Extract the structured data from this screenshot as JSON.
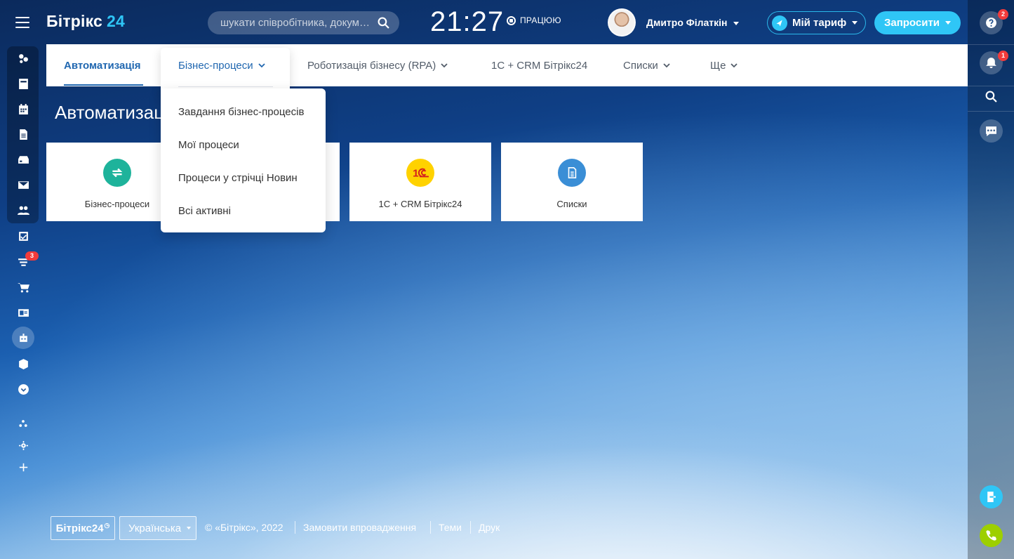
{
  "header": {
    "logo_text": "Бітрікс",
    "logo_num": "24",
    "search_placeholder": "шукати співробітника, докум…",
    "clock": "21:27",
    "status": "ПРАЦЮЮ",
    "user_name": "Дмитро Філаткін",
    "tariff_label": "Мій тариф",
    "invite_label": "Запросити"
  },
  "left_sidebar": {
    "badge": "3",
    "icons": [
      "feed-icon",
      "chat-icon",
      "calendar-icon",
      "documents-icon",
      "drive-icon",
      "mail-icon",
      "groups-icon",
      "tasks-icon",
      "crm-funnel-icon",
      "shop-icon",
      "contact-center-icon",
      "automation-robot-icon",
      "store-box-icon",
      "more-chevron-icon",
      "sitemap-icon",
      "settings-gear-icon",
      "add-plus-icon"
    ]
  },
  "right_bar": {
    "help_badge": "2",
    "notif_badge": "1"
  },
  "nav": {
    "items": [
      {
        "label": "Автоматизація"
      },
      {
        "label": "Бізнес-процеси"
      },
      {
        "label": "Роботизація бізнесу (RPA)"
      },
      {
        "label": "1С + CRM Бітрікс24"
      },
      {
        "label": "Списки"
      },
      {
        "label": "Ще"
      }
    ]
  },
  "page": {
    "title": "Автоматизація"
  },
  "tiles": [
    {
      "label": "Бізнес-процеси",
      "color": "#1eb39b"
    },
    {
      "label": "1С + CRM Бітрікс24",
      "color": "#ffd200"
    },
    {
      "label": "Списки",
      "color": "#3a8ed6"
    }
  ],
  "dropdown": {
    "items": [
      {
        "label": "Завдання бізнес-процесів"
      },
      {
        "label": "Мої процеси"
      },
      {
        "label": "Процеси у стрічці Новин"
      },
      {
        "label": "Всі активні"
      }
    ]
  },
  "footer": {
    "logo": "Бітрікс24",
    "language": "Українська",
    "copyright": "© «Бітрікс», 2022",
    "order_link": "Замовити впровадження",
    "themes_link": "Теми",
    "print_link": "Друк"
  },
  "colors": {
    "accent": "#2fc6f6",
    "active_nav": "#2067b0",
    "badge": "#f23b3b",
    "phone": "#9dcf00"
  }
}
